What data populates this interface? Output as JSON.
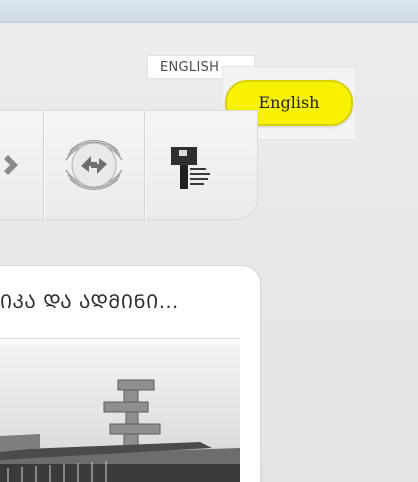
{
  "header": {
    "language_link": "ENGLISH"
  },
  "tooltip": {
    "text": "English",
    "color": "#f7f200"
  },
  "icon_panel": {
    "items": [
      {
        "icon": "arrow-right-icon"
      },
      {
        "icon": "exchange-arrows-icon"
      },
      {
        "icon": "institution-logo-icon"
      }
    ]
  },
  "card": {
    "title": "ᲘᲙᲐ ᲓᲐ ᲐᲓᲛᲘᲜᲘ...",
    "image": "building-photo"
  }
}
